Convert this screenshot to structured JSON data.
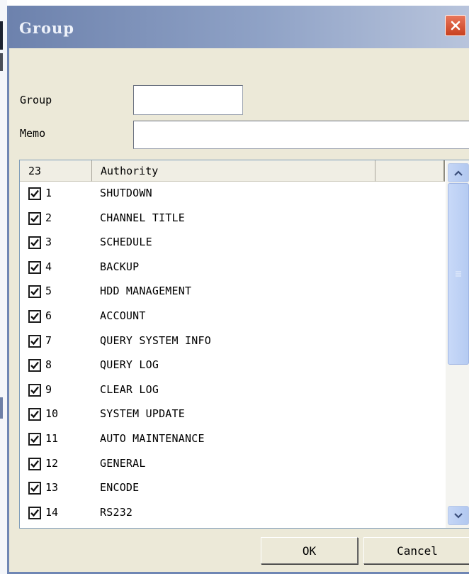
{
  "window": {
    "title": "Group"
  },
  "form": {
    "group_label": "Group",
    "group_value": "",
    "memo_label": "Memo",
    "memo_value": ""
  },
  "table": {
    "columns": [
      "23",
      "Authority",
      ""
    ],
    "rows": [
      {
        "num": "1",
        "authority": "SHUTDOWN",
        "checked": true
      },
      {
        "num": "2",
        "authority": "CHANNEL TITLE",
        "checked": true
      },
      {
        "num": "3",
        "authority": "SCHEDULE",
        "checked": true
      },
      {
        "num": "4",
        "authority": "BACKUP",
        "checked": true
      },
      {
        "num": "5",
        "authority": "HDD MANAGEMENT",
        "checked": true
      },
      {
        "num": "6",
        "authority": "ACCOUNT",
        "checked": true
      },
      {
        "num": "7",
        "authority": "QUERY SYSTEM INFO",
        "checked": true
      },
      {
        "num": "8",
        "authority": "QUERY LOG",
        "checked": true
      },
      {
        "num": "9",
        "authority": "CLEAR LOG",
        "checked": true
      },
      {
        "num": "10",
        "authority": "SYSTEM UPDATE",
        "checked": true
      },
      {
        "num": "11",
        "authority": "AUTO MAINTENANCE",
        "checked": true
      },
      {
        "num": "12",
        "authority": "GENERAL",
        "checked": true
      },
      {
        "num": "13",
        "authority": "ENCODE",
        "checked": true
      },
      {
        "num": "14",
        "authority": "RS232",
        "checked": true
      }
    ]
  },
  "buttons": {
    "ok": "OK",
    "cancel": "Cancel"
  },
  "icons": {
    "close": "close-icon",
    "scroll_up": "chevron-up-icon",
    "scroll_down": "chevron-down-icon",
    "checkbox": "checkmark-icon"
  },
  "colors": {
    "dialog_bg": "#ece9d8",
    "close_button": "#d2502e",
    "scrollbar": "#b8cdf2"
  }
}
